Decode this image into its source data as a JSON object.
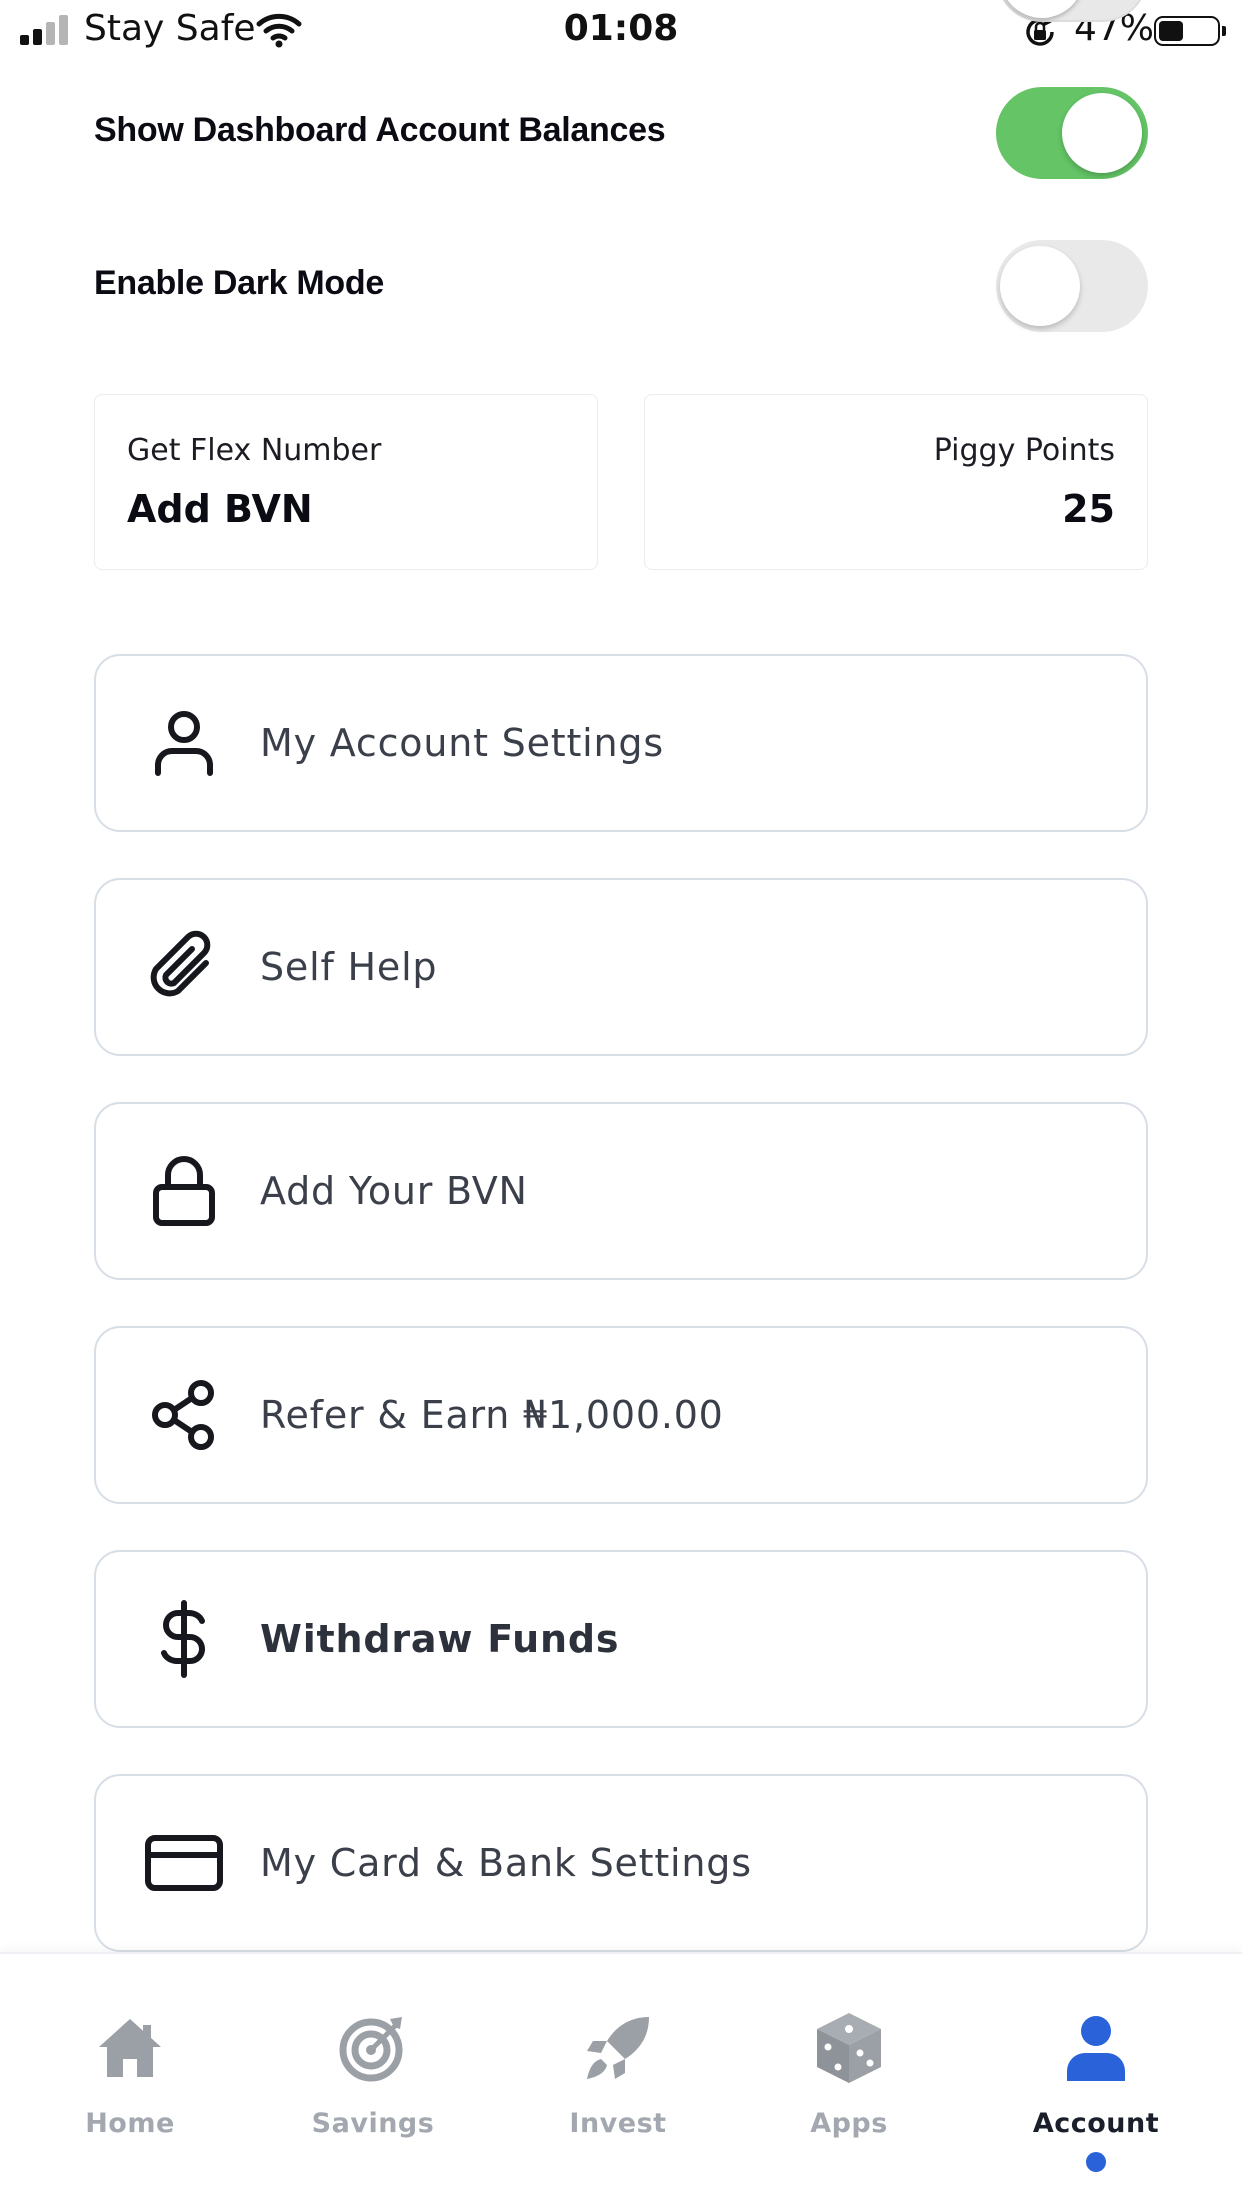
{
  "status_bar": {
    "carrier": "Stay Safe",
    "time": "01:08",
    "battery_percent": "47%",
    "battery_level": 0.47
  },
  "settings": {
    "show_balances": {
      "label": "Show Dashboard Account Balances",
      "enabled": true
    },
    "dark_mode": {
      "label": "Enable Dark Mode",
      "enabled": false
    }
  },
  "info_cards": {
    "flex_number": {
      "caption": "Get Flex Number",
      "value": "Add BVN"
    },
    "piggy_points": {
      "caption": "Piggy Points",
      "value": "25"
    }
  },
  "menu": [
    {
      "label": "My Account Settings",
      "icon": "user-icon"
    },
    {
      "label": "Self Help",
      "icon": "paperclip-icon"
    },
    {
      "label": "Add Your BVN",
      "icon": "lock-icon"
    },
    {
      "label": "Refer & Earn ₦1,000.00",
      "icon": "share-icon"
    },
    {
      "label": "Withdraw Funds",
      "icon": "dollar-icon"
    },
    {
      "label": "My Card & Bank Settings",
      "icon": "credit-card-icon"
    }
  ],
  "tabs": [
    {
      "label": "Home",
      "icon": "home-icon",
      "active": false
    },
    {
      "label": "Savings",
      "icon": "target-icon",
      "active": false
    },
    {
      "label": "Invest",
      "icon": "rocket-icon",
      "active": false
    },
    {
      "label": "Apps",
      "icon": "cube-icon",
      "active": false
    },
    {
      "label": "Account",
      "icon": "user-icon",
      "active": true
    }
  ],
  "colors": {
    "toggle_on": "#64c466",
    "toggle_off": "#e9e9ea",
    "accent_blue": "#2962d9",
    "inactive_tab": "#a3a8b0"
  }
}
